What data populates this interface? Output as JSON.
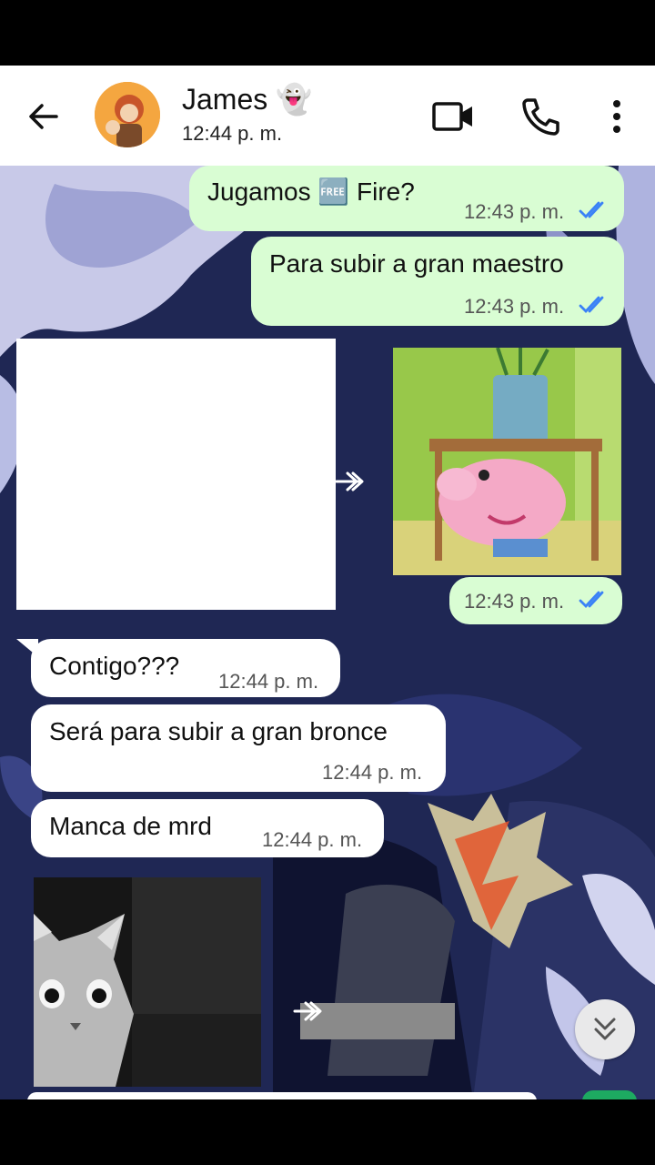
{
  "contact": {
    "name": "James 👻",
    "status": "12:44 p. m."
  },
  "messages": [
    {
      "text": "Jugamos 🆓 Fire?",
      "time": "12:43 p. m."
    },
    {
      "text": "Para subir a gran maestro",
      "time": "12:43 p. m."
    },
    {
      "time": "12:43 p. m."
    },
    {
      "text": "Contigo???",
      "time": "12:44 p. m."
    },
    {
      "text": "Será para subir a gran bronce",
      "time": "12:44 p. m."
    },
    {
      "text": "Manca de mrd",
      "time": "12:44 p. m."
    }
  ],
  "colors": {
    "outgoing": "#d9fdd3",
    "incoming": "#ffffff",
    "read_ticks": "#3b82f6"
  }
}
